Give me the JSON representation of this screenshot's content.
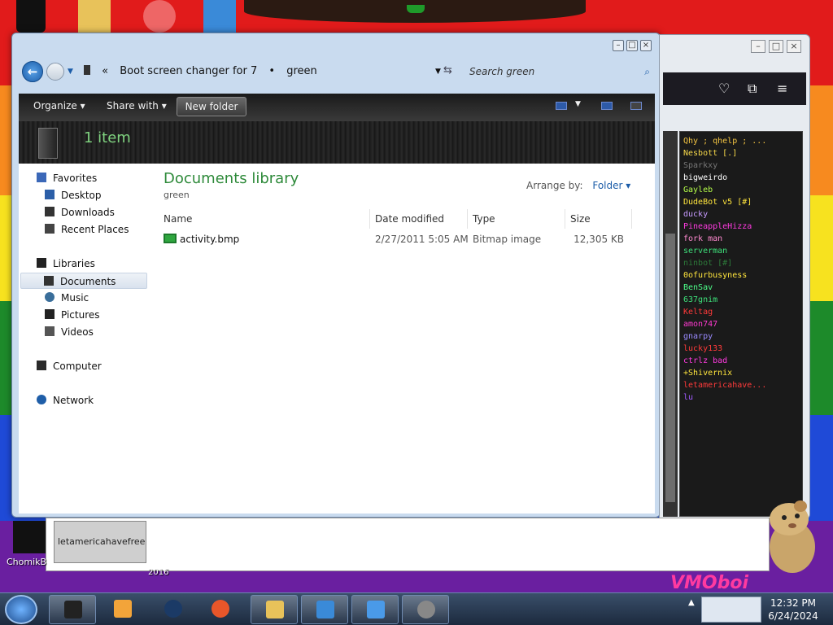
{
  "explorer": {
    "breadcrumb": [
      "Boot screen changer for 7",
      "green"
    ],
    "search_placeholder": "Search green",
    "toolbar": {
      "organize": "Organize",
      "share_with": "Share with",
      "new_folder": "New folder"
    },
    "item_count": "1 item",
    "nav": {
      "favorites": "Favorites",
      "favorites_items": [
        "Desktop",
        "Downloads",
        "Recent Places"
      ],
      "libraries": "Libraries",
      "libraries_items": [
        "Documents",
        "Music",
        "Pictures",
        "Videos"
      ],
      "computer": "Computer",
      "network": "Network"
    },
    "library_title": "Documents library",
    "library_subtitle": "green",
    "arrange_label": "Arrange by:",
    "arrange_value": "Folder",
    "columns": [
      "Name",
      "Date modified",
      "Type",
      "Size"
    ],
    "files": [
      {
        "name": "activity.bmp",
        "date": "2/27/2011 5:05 AM",
        "type": "Bitmap image",
        "size": "12,305 KB"
      }
    ]
  },
  "chat": {
    "users": [
      {
        "name": "Qhy ; qhelp ; ...",
        "color": "#f4c542"
      },
      {
        "name": "Nesbott [.]",
        "color": "#f7d94a"
      },
      {
        "name": "Sparkxy",
        "color": "#777777"
      },
      {
        "name": "bigweirdo",
        "color": "#ffffff"
      },
      {
        "name": "Gayleb",
        "color": "#b6ff4a"
      },
      {
        "name": "DudeBot v5 [#]",
        "color": "#ffe53d"
      },
      {
        "name": "ducky",
        "color": "#c79bff"
      },
      {
        "name": "PineappleHizza",
        "color": "#ff3ae0"
      },
      {
        "name": "fork man",
        "color": "#ff8ad0"
      },
      {
        "name": "serverman",
        "color": "#3ee07a"
      },
      {
        "name": "ninbot [#]",
        "color": "#2d7a3a"
      },
      {
        "name": "0ofurbusyness",
        "color": "#ffe53d"
      },
      {
        "name": "BenSav",
        "color": "#4dff8a"
      },
      {
        "name": "637gnim",
        "color": "#3ee07a"
      },
      {
        "name": "Keltag",
        "color": "#ff3a3a"
      },
      {
        "name": "amon747",
        "color": "#ff3ad0"
      },
      {
        "name": "gnarpy",
        "color": "#9a8aff"
      },
      {
        "name": "lucky133",
        "color": "#ff3a3a"
      },
      {
        "name": "ctrlz bad",
        "color": "#ff3ae0"
      },
      {
        "name": "+Shivernix",
        "color": "#ffe53d"
      },
      {
        "name": "letamericahave...",
        "color": "#ff3a3a"
      },
      {
        "name": "lu",
        "color": "#a05aff"
      }
    ]
  },
  "desktop": {
    "lower_tab": "letamericahavefreedo",
    "icon_label": "ChomikB",
    "year_label": "2016",
    "watermark": "VMOboi"
  },
  "taskbar": {
    "time": "12:32 PM",
    "date": "6/24/2024"
  },
  "colors": {
    "accent_green": "#2e8a3a",
    "link_blue": "#1b5ca8"
  }
}
